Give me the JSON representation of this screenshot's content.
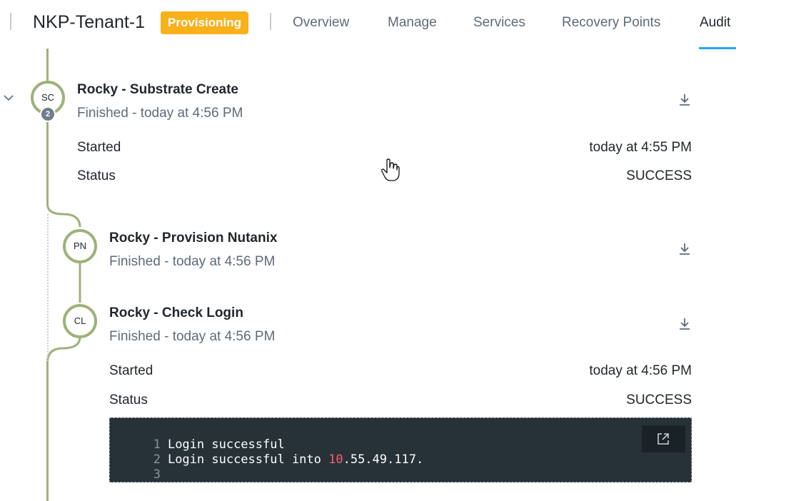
{
  "header": {
    "title": "NKP-Tenant-1",
    "badge": "Provisioning",
    "badge_color": "#f8b01b",
    "tabs": [
      "Overview",
      "Manage",
      "Services",
      "Recovery Points",
      "Audit"
    ],
    "active_tab": "Audit"
  },
  "timeline": {
    "rail_color": "#9fb27a",
    "parent": {
      "initials": "SC",
      "child_count": "2",
      "title": "Rocky - Substrate Create",
      "subtitle": "Finished - today at 4:56 PM",
      "started_label": "Started",
      "started_value": "today at 4:55 PM",
      "status_label": "Status",
      "status_value": "SUCCESS"
    },
    "children": [
      {
        "initials": "PN",
        "title": "Rocky - Provision Nutanix",
        "subtitle": "Finished - today at 4:56 PM"
      },
      {
        "initials": "CL",
        "title": "Rocky - Check Login",
        "subtitle": "Finished - today at 4:56 PM",
        "started_label": "Started",
        "started_value": "today at 4:56 PM",
        "status_label": "Status",
        "status_value": "SUCCESS"
      }
    ]
  },
  "console": {
    "lines": [
      {
        "num": "1",
        "text": "Login successful"
      },
      {
        "num": "2",
        "prefix": "Login successful into ",
        "highlight": "10",
        "suffix": ".55.49.117."
      },
      {
        "num": "3",
        "text": ""
      }
    ],
    "highlight_color": "#ff5a73"
  },
  "icons": {
    "collapse": "chevron-down-icon",
    "download": "download-icon",
    "popout": "external-link-icon",
    "cursor": "hand-pointer-icon"
  }
}
